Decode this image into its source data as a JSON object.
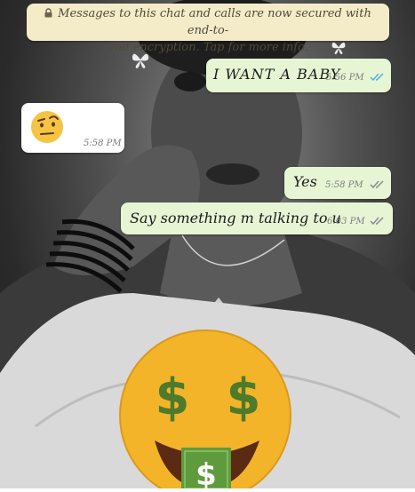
{
  "banner": {
    "icon": "lock-icon",
    "line1": "Messages to this chat and calls are now secured with end-to-",
    "line2": "end encryption. Tap for more info."
  },
  "messages": [
    {
      "direction": "outgoing",
      "text": "I WANT A BABY",
      "time": "5:56 PM",
      "status": "read"
    },
    {
      "direction": "incoming",
      "emoji": "raised-eyebrow-face",
      "time": "5:58 PM"
    },
    {
      "direction": "outgoing",
      "text": "Yes",
      "time": "5:58 PM",
      "status": "delivered"
    },
    {
      "direction": "outgoing",
      "text": "Say something m talking to u",
      "time": "6:03 PM",
      "status": "delivered"
    }
  ],
  "sticker": {
    "name": "money-mouth-face-emoji",
    "symbol": "$"
  },
  "colors": {
    "banner_bg": "#f4ecc8",
    "outgoing_bg": "#e6f6d4",
    "incoming_bg": "#ffffff",
    "read_ticks": "#4fb0e6",
    "delivered_ticks": "#8a8a8a",
    "sticker_yellow": "#f3b42a"
  }
}
